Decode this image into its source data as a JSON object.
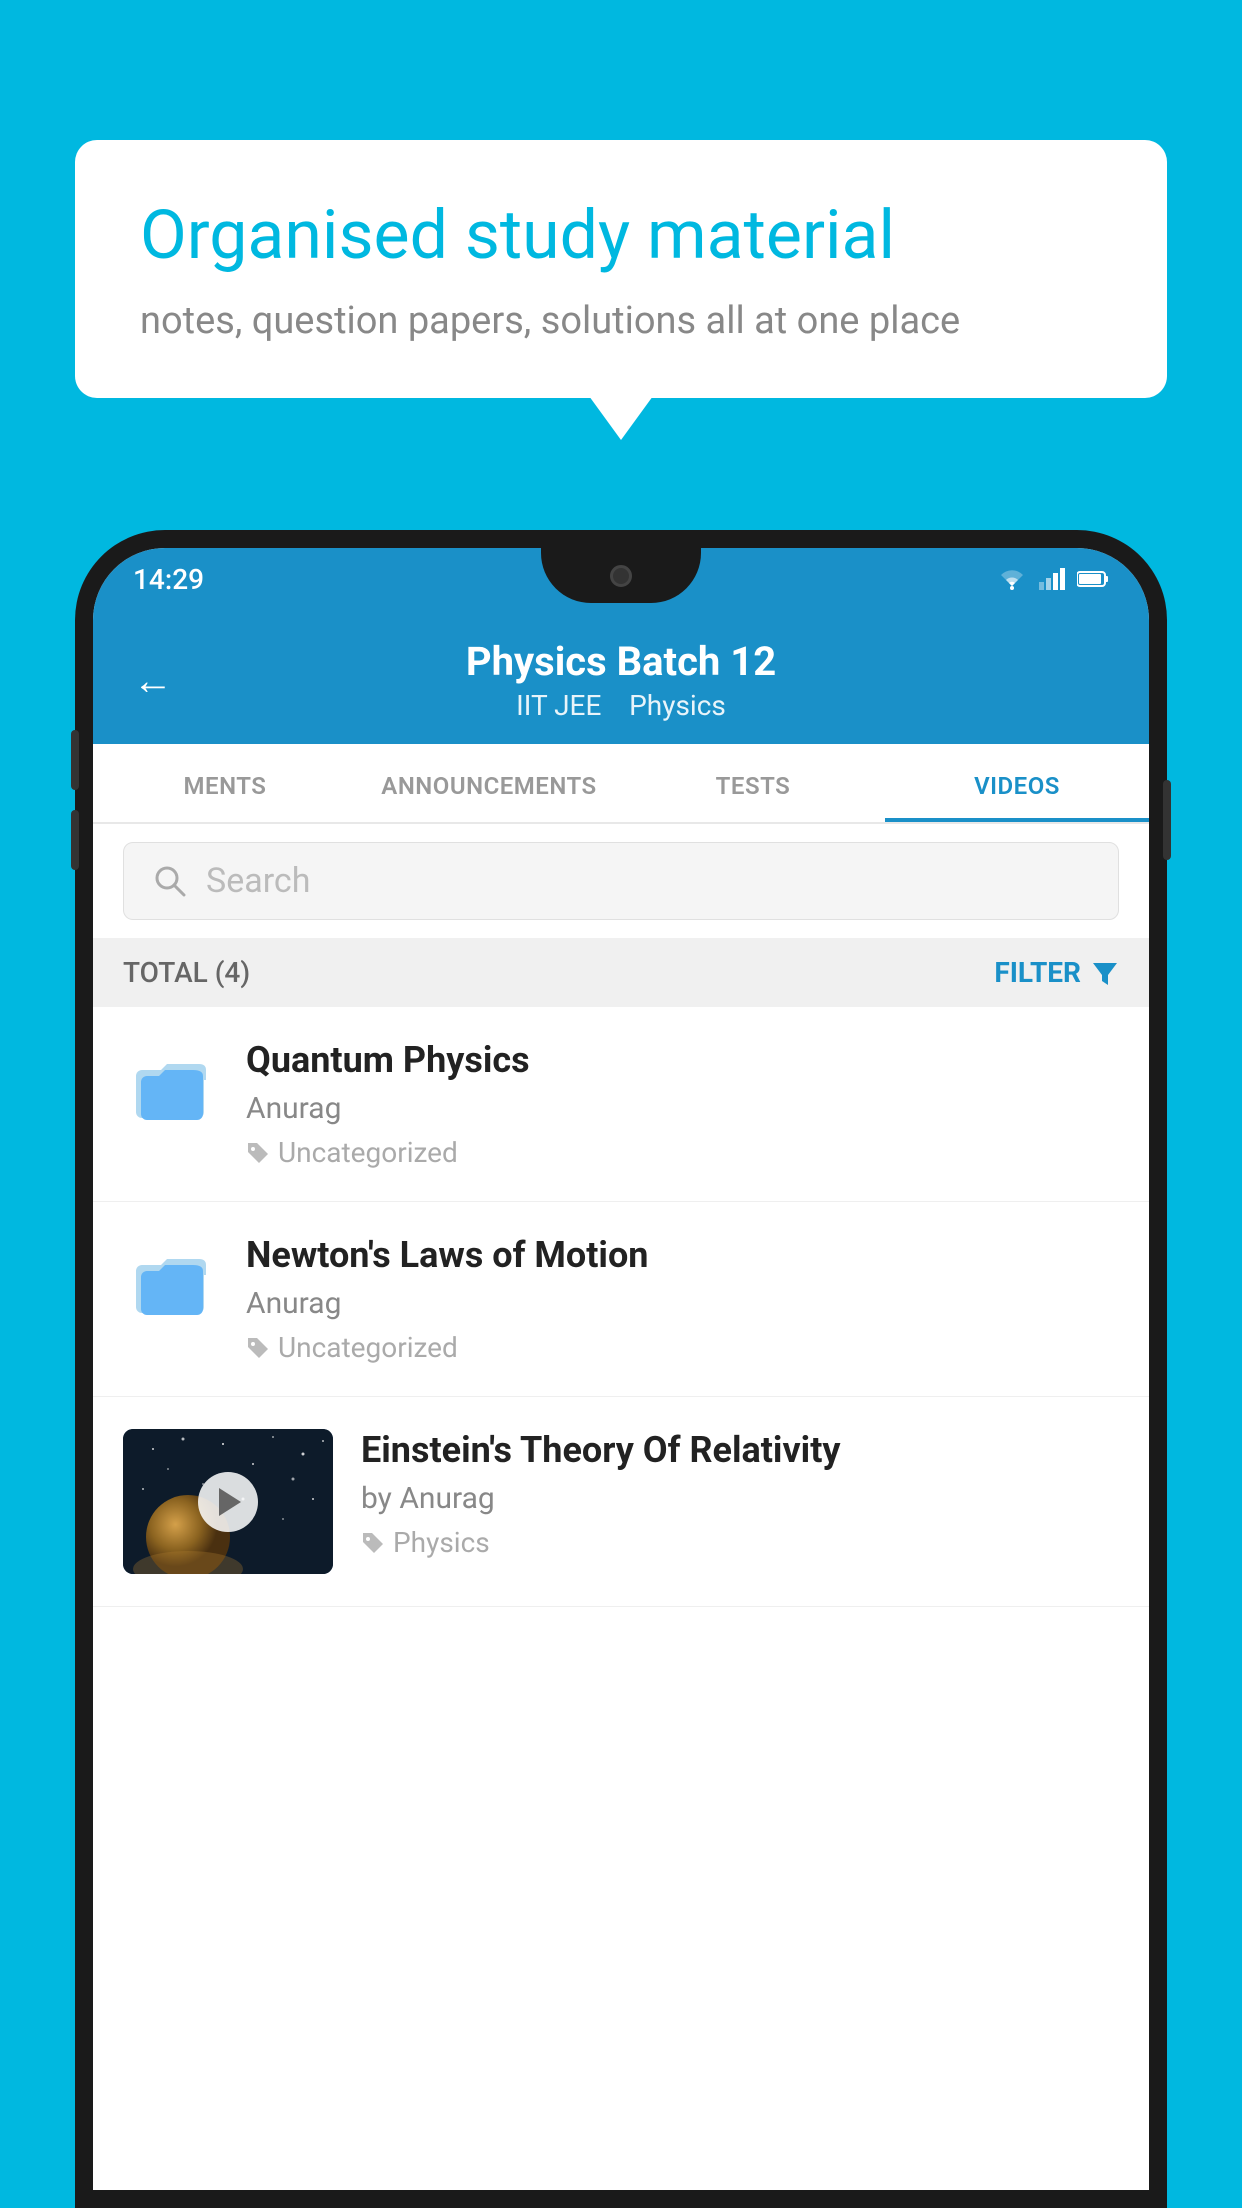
{
  "bubble": {
    "title": "Organised study material",
    "subtitle": "notes, question papers, solutions all at one place"
  },
  "statusBar": {
    "time": "14:29",
    "icons": [
      "wifi",
      "signal",
      "battery"
    ]
  },
  "header": {
    "title": "Physics Batch 12",
    "subtitle_parts": [
      "IIT JEE",
      "Physics"
    ],
    "back_label": "←"
  },
  "tabs": [
    {
      "label": "MENTS",
      "active": false
    },
    {
      "label": "ANNOUNCEMENTS",
      "active": false
    },
    {
      "label": "TESTS",
      "active": false
    },
    {
      "label": "VIDEOS",
      "active": true
    }
  ],
  "search": {
    "placeholder": "Search"
  },
  "filter_row": {
    "total_label": "TOTAL (4)",
    "filter_label": "FILTER"
  },
  "videos": [
    {
      "id": 1,
      "title": "Quantum Physics",
      "author": "Anurag",
      "tag": "Uncategorized",
      "has_thumb": false
    },
    {
      "id": 2,
      "title": "Newton's Laws of Motion",
      "author": "Anurag",
      "tag": "Uncategorized",
      "has_thumb": false
    },
    {
      "id": 3,
      "title": "Einstein's Theory Of Relativity",
      "author": "by Anurag",
      "tag": "Physics",
      "has_thumb": true
    }
  ],
  "colors": {
    "primary": "#1a90c8",
    "background": "#00b8e0",
    "white": "#ffffff",
    "text_dark": "#222222",
    "text_medium": "#888888",
    "text_light": "#aaaaaa"
  }
}
